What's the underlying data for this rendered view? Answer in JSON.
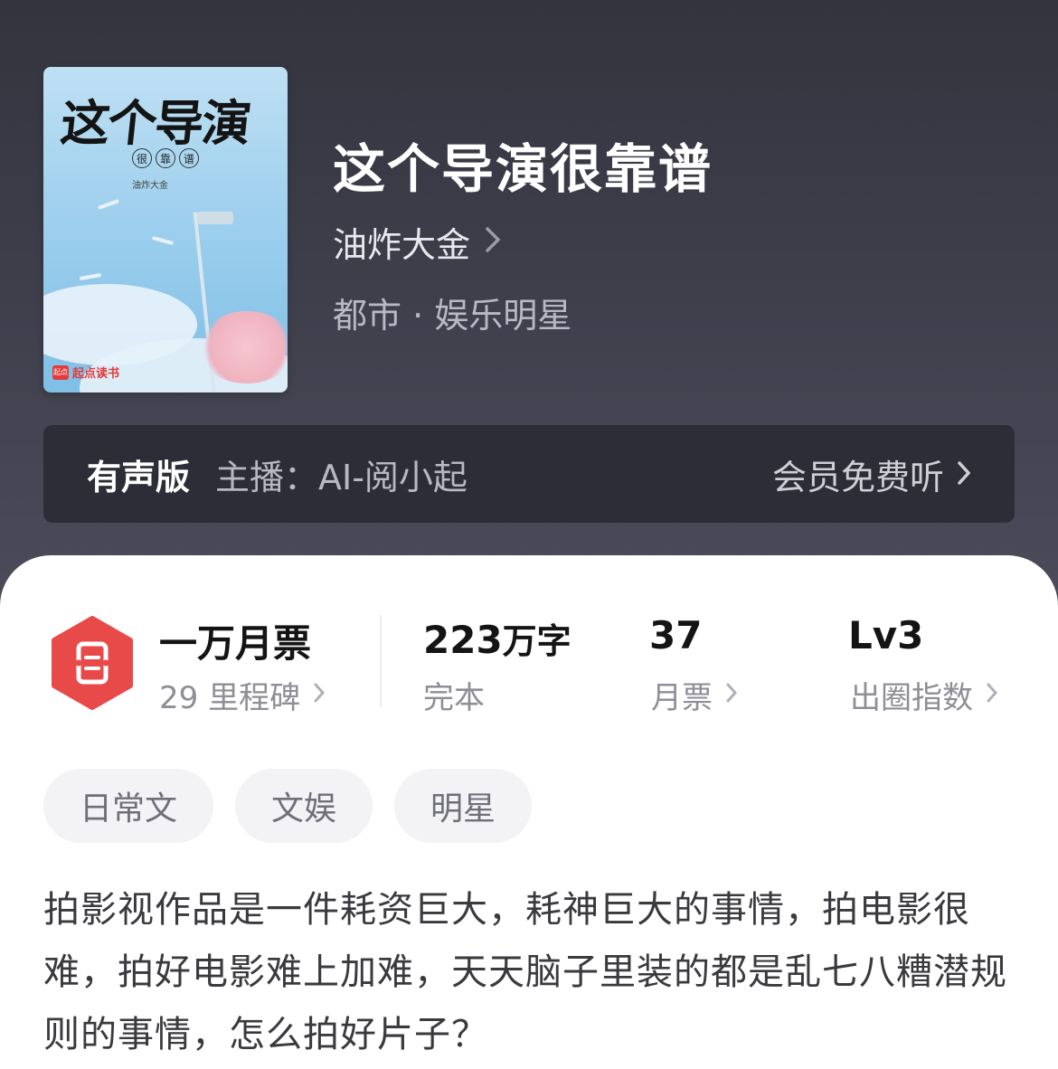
{
  "book": {
    "title": "这个导演很靠谱",
    "author": "油炸大金",
    "genre": "都市 · 娱乐明星",
    "cover": {
      "title": "这个导演",
      "subtitle_chars": [
        "很",
        "靠",
        "谱"
      ],
      "author": "油炸大金",
      "publisher": "起点读书",
      "publisher_badge": "起点"
    }
  },
  "audio": {
    "label": "有声版",
    "host": "主播：AI-阅小起",
    "cta": "会员免费听"
  },
  "stats": {
    "ticket": {
      "main": "一万月票",
      "sub": "29 里程碑"
    },
    "words": {
      "number": "223",
      "unit": "万字",
      "sub": "完本"
    },
    "monthly": {
      "main": "37",
      "sub": "月票"
    },
    "level": {
      "main": "Lv3",
      "sub": "出圈指数"
    }
  },
  "tags": [
    "日常文",
    "文娱",
    "明星"
  ],
  "description": "拍影视作品是一件耗资巨大，耗神巨大的事情，拍电影很难，拍好电影难上加难，天天脑子里装的都是乱七八糟潜规则的事情，怎么拍好片子？",
  "colors": {
    "header_bg": "#3e3e4b",
    "accent_red": "#e84a4a",
    "card_bg": "#ffffff"
  }
}
